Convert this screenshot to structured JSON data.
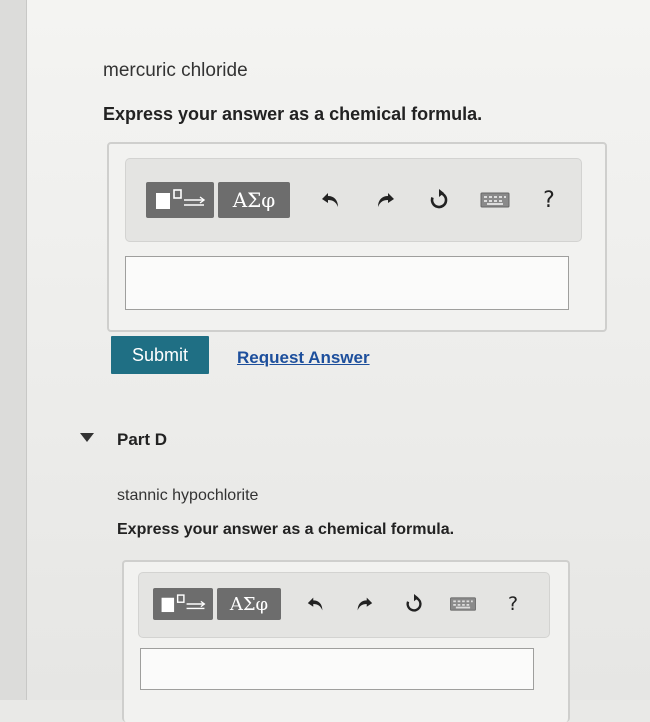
{
  "part_c": {
    "compound": "mercuric chloride",
    "instruction": "Express your answer as a chemical formula.",
    "toolbar": {
      "greek_label": "ΑΣφ",
      "help_label": "?"
    },
    "answer_value": "",
    "submit_label": "Submit",
    "request_label": "Request Answer"
  },
  "part_d": {
    "title": "Part D",
    "compound": "stannic hypochlorite",
    "instruction": "Express your answer as a chemical formula.",
    "toolbar": {
      "greek_label": "ΑΣφ",
      "help_label": "?"
    },
    "answer_value": ""
  },
  "icons": [
    "templates-icon",
    "undo-icon",
    "redo-icon",
    "reset-icon",
    "keyboard-icon",
    "help-icon",
    "collapse-caret-icon"
  ],
  "colors": {
    "submit": "#1f6f84",
    "link": "#1d4f9c",
    "toolbar_button": "#6d6d6d"
  }
}
